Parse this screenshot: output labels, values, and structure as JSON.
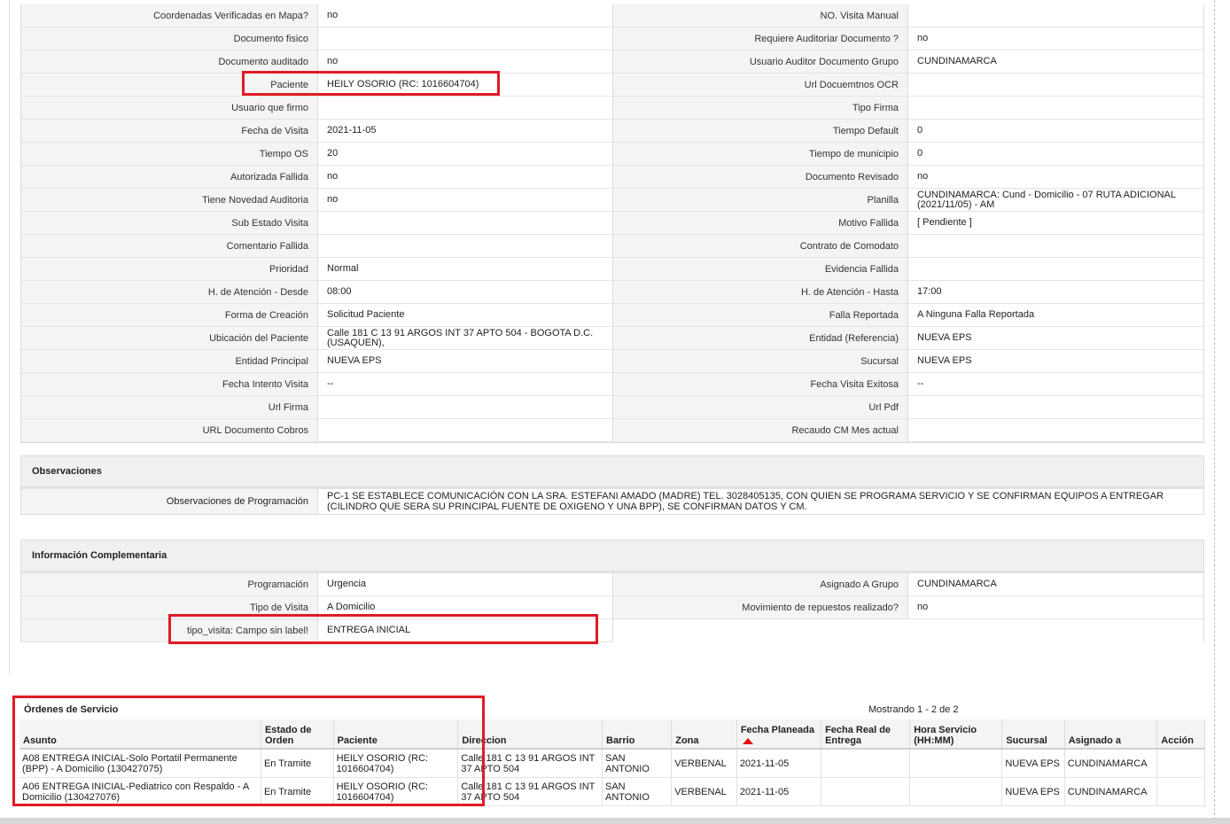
{
  "detail_rows": [
    {
      "l1": "Coordenadas Verificadas en Mapa?",
      "v1": "no",
      "l2": "NO. Visita Manual",
      "v2": ""
    },
    {
      "l1": "Documento fisico",
      "v1": "",
      "l2": "Requiere Auditoriar Documento ?",
      "v2": "no"
    },
    {
      "l1": "Documento auditado",
      "v1": "no",
      "l2": "Usuario Auditor Documento Grupo",
      "v2": "CUNDINAMARCA"
    },
    {
      "l1": "Paciente",
      "v1": "HEILY OSORIO (RC: 1016604704)",
      "l2": "Url Docuemtnos OCR",
      "v2": ""
    },
    {
      "l1": "Usuario que firmo",
      "v1": "",
      "l2": "Tipo Firma",
      "v2": ""
    },
    {
      "l1": "Fecha de Visita",
      "v1": "2021-11-05",
      "l2": "Tiempo Default",
      "v2": "0"
    },
    {
      "l1": "Tiempo OS",
      "v1": "20",
      "l2": "Tiempo de municipio",
      "v2": "0"
    },
    {
      "l1": "Autorizada Fallida",
      "v1": "no",
      "l2": "Documento Revisado",
      "v2": "no"
    },
    {
      "l1": "Tiene Novedad Auditoria",
      "v1": "no",
      "l2": "Planilla",
      "v2": "CUNDINAMARCA: Cund - Domicilio - 07 RUTA ADICIONAL (2021/11/05) - AM"
    },
    {
      "l1": "Sub Estado Visita",
      "v1": "",
      "l2": "Motivo Fallida",
      "v2": "[ Pendiente ]"
    },
    {
      "l1": "Comentario Fallida",
      "v1": "",
      "l2": "Contrato de Comodato",
      "v2": ""
    },
    {
      "l1": "Prioridad",
      "v1": "Normal",
      "l2": "Evidencia Fallida",
      "v2": ""
    },
    {
      "l1": "H. de Atención - Desde",
      "v1": "08:00",
      "l2": "H. de Atención - Hasta",
      "v2": "17:00"
    },
    {
      "l1": "Forma de Creación",
      "v1": "Solicitud Paciente",
      "l2": "Falla Reportada",
      "v2": "A Ninguna Falla Reportada"
    },
    {
      "l1": "Ubicación del Paciente",
      "v1": "Calle 181 C 13 91 ARGOS INT 37 APTO 504 - BOGOTA D.C. (USAQUEN),",
      "l2": "Entidad (Referencia)",
      "v2": "NUEVA EPS"
    },
    {
      "l1": "Entidad Principal",
      "v1": "NUEVA EPS",
      "l2": "Sucursal",
      "v2": "NUEVA EPS"
    },
    {
      "l1": "Fecha Intento Visita",
      "v1": "--",
      "l2": "Fecha Visita Exitosa",
      "v2": "--"
    },
    {
      "l1": "Url Firma",
      "v1": "",
      "l2": "Url Pdf",
      "v2": ""
    },
    {
      "l1": "URL Documento Cobros",
      "v1": "",
      "l2": "Recaudo CM Mes actual",
      "v2": ""
    }
  ],
  "observaciones": {
    "title": "Observaciones",
    "label": "Observaciones de Programación",
    "value": "PC-1 SE ESTABLECE COMUNICACIÓN CON LA SRA. ESTEFANI AMADO (MADRE) TEL. 3028405135, CON QUIEN SE PROGRAMA SERVICIO Y SE CONFIRMAN EQUIPOS A ENTREGAR (CILINDRO QUE SERA SU PRINCIPAL FUENTE DE OXIGENO Y UNA BPP), SE CONFIRMAN DATOS Y CM."
  },
  "info": {
    "title": "Información Complementaria",
    "rows": [
      {
        "l1": "Programación",
        "v1": "Urgencia",
        "l2": "Asignado A Grupo",
        "v2": "CUNDINAMARCA"
      },
      {
        "l1": "Tipo de Visita",
        "v1": "A Domicilio",
        "l2": "Movimiento de repuestos realizado?",
        "v2": "no"
      }
    ],
    "single": {
      "l1": "tipo_visita: Campo sin label!",
      "v1": "ENTREGA INICIAL"
    }
  },
  "orders": {
    "title": "Órdenes de Servicio",
    "count": "Mostrando 1 - 2 de 2",
    "headers": [
      "Asunto",
      "Estado de Orden",
      "Paciente",
      "Direccion",
      "Barrio",
      "Zona",
      "Fecha Planeada",
      "Fecha Real de Entrega",
      "Hora Servicio (HH:MM)",
      "Sucursal",
      "Asignado a",
      "Acción"
    ],
    "rows": [
      [
        "A08 ENTREGA INICIAL-Solo Portatil Permanente (BPP) - A Domicilio (130427075)",
        "En Tramite",
        "HEILY OSORIO (RC: 1016604704)",
        "Calle 181 C 13 91 ARGOS INT 37 APTO 504",
        "SAN ANTONIO",
        "VERBENAL",
        "2021-11-05",
        "",
        "",
        "NUEVA EPS",
        "CUNDINAMARCA",
        ""
      ],
      [
        "A06 ENTREGA INICIAL-Pediatrico con Respaldo - A Domicilio (130427076)",
        "En Tramite",
        "HEILY OSORIO (RC: 1016604704)",
        "Calle 181 C 13 91 ARGOS INT 37 APTO 504",
        "SAN ANTONIO",
        "VERBENAL",
        "2021-11-05",
        "",
        "",
        "NUEVA EPS",
        "CUNDINAMARCA",
        ""
      ]
    ]
  },
  "colors": {
    "highlight": "#e01b24"
  }
}
